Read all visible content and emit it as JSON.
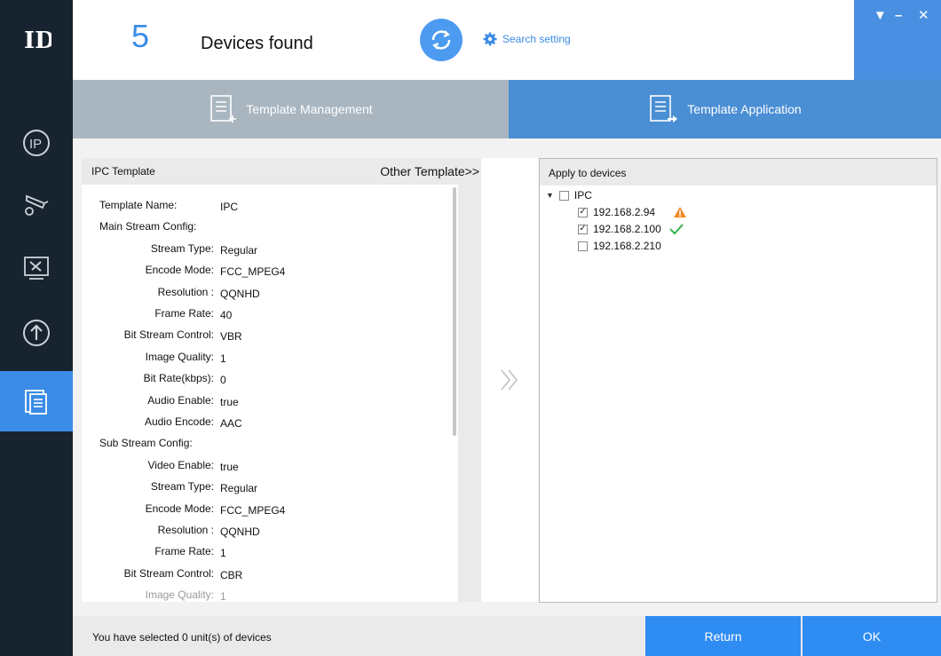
{
  "header": {
    "device_count": "5",
    "found_label": "Devices found",
    "search_setting_label": "Search setting",
    "colors": {
      "accent": "#3b8ce6",
      "sidebar": "#17242f"
    }
  },
  "tabs": [
    {
      "label": "Template Management",
      "active": false
    },
    {
      "label": "Template Application",
      "active": true
    }
  ],
  "left_panel": {
    "title": "IPC Template",
    "other_template_label": "Other Template>>",
    "rows": [
      {
        "key": "Template Name:",
        "value": "IPC"
      },
      {
        "section": "Main Stream Config:"
      },
      {
        "key": "Stream Type:",
        "value": "Regular"
      },
      {
        "key": "Encode Mode:",
        "value": "FCC_MPEG4"
      },
      {
        "key": "Resolution :",
        "value": "QQNHD"
      },
      {
        "key": "Frame Rate:",
        "value": "40"
      },
      {
        "key": "Bit Stream Control:",
        "value": "VBR"
      },
      {
        "key": "Image Quality:",
        "value": "1"
      },
      {
        "key": "Bit Rate(kbps):",
        "value": "0"
      },
      {
        "key": "Audio Enable:",
        "value": "true"
      },
      {
        "key": "Audio Encode:",
        "value": "AAC"
      },
      {
        "section": "Sub Stream Config:"
      },
      {
        "key": "Video Enable:",
        "value": "true"
      },
      {
        "key": "Stream Type:",
        "value": "Regular"
      },
      {
        "key": "Encode Mode:",
        "value": "FCC_MPEG4"
      },
      {
        "key": "Resolution :",
        "value": "QQNHD"
      },
      {
        "key": "Frame Rate:",
        "value": "1"
      },
      {
        "key": "Bit Stream Control:",
        "value": "CBR"
      },
      {
        "key": "Image Quality:",
        "value": "1"
      }
    ]
  },
  "right_panel": {
    "title": "Apply to devices",
    "group": {
      "label": "IPC",
      "checked": false
    },
    "devices": [
      {
        "ip": "192.168.2.94",
        "checked": true,
        "status": "warning-icon"
      },
      {
        "ip": "192.168.2.100",
        "checked": true,
        "status": "check-icon"
      },
      {
        "ip": "192.168.2.210",
        "checked": false,
        "status": ""
      }
    ]
  },
  "footer": {
    "status_text": "You have selected 0 unit(s) of devices",
    "return_label": "Return",
    "ok_label": "OK"
  }
}
